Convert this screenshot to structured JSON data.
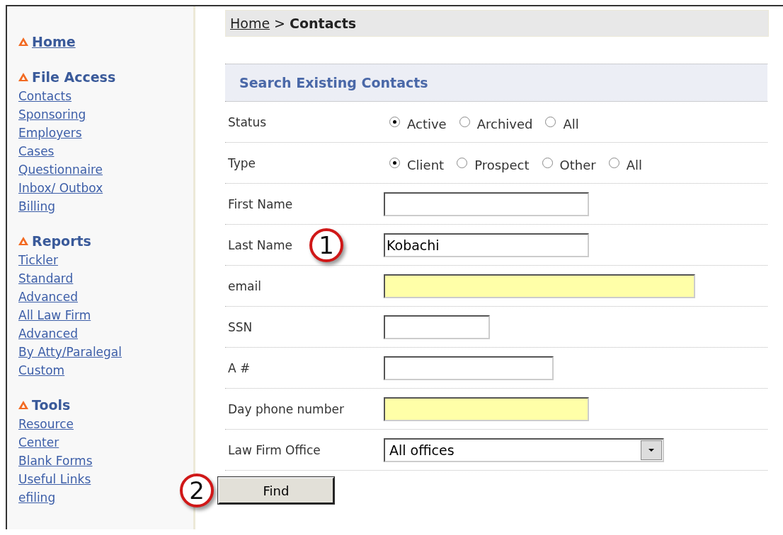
{
  "sidebar": {
    "sections": [
      {
        "title": "Home"
      },
      {
        "title": "File Access",
        "items": [
          "Contacts",
          "Sponsoring",
          "Employers",
          "Cases",
          "Questionnaire",
          "Inbox/ Outbox",
          "Billing"
        ]
      },
      {
        "title": "Reports",
        "items": [
          "Tickler",
          "Standard",
          "Advanced",
          "All Law Firm",
          "Advanced",
          "By Atty/Paralegal",
          "Custom"
        ]
      },
      {
        "title": "Tools",
        "items": [
          "Resource",
          "Center",
          "Blank Forms",
          "Useful Links",
          "efiling"
        ]
      }
    ]
  },
  "breadcrumb": {
    "link": "Home",
    "separator": ">",
    "current": "Contacts"
  },
  "form": {
    "title": "Search Existing Contacts",
    "rows": [
      {
        "kind": "radio",
        "label": "Status",
        "options": [
          {
            "label": "Active",
            "selected": true
          },
          {
            "label": "Archived",
            "selected": false
          },
          {
            "label": "All",
            "selected": false
          }
        ]
      },
      {
        "kind": "radio",
        "label": "Type",
        "options": [
          {
            "label": "Client",
            "selected": true
          },
          {
            "label": "Prospect",
            "selected": false
          },
          {
            "label": "Other",
            "selected": false
          },
          {
            "label": "All",
            "selected": false
          }
        ]
      },
      {
        "kind": "text",
        "label": "First Name",
        "highlighted": false
      },
      {
        "kind": "text",
        "label": "Last Name",
        "value": "Kobachi",
        "highlighted": false,
        "callout": "1"
      },
      {
        "kind": "text",
        "label": "email",
        "highlighted": true
      },
      {
        "kind": "text",
        "label": "SSN",
        "highlighted": false
      },
      {
        "kind": "text",
        "label": "A #",
        "highlighted": false
      },
      {
        "kind": "text",
        "label": "Day phone number",
        "highlighted": true
      },
      {
        "kind": "select",
        "label": "Law Firm Office",
        "value": "All offices"
      }
    ]
  },
  "find_button": {
    "label": "Find",
    "callout": "2"
  }
}
